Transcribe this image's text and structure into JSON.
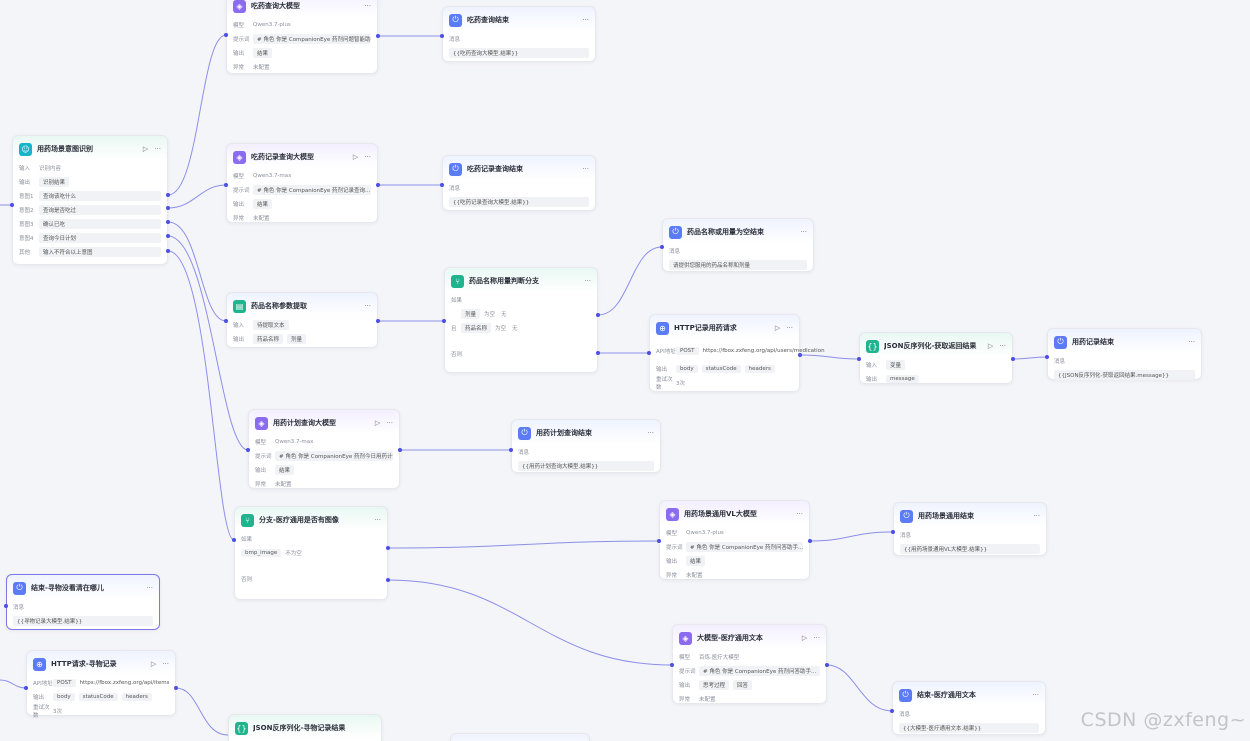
{
  "colors": {
    "accent": "#4b4fe3",
    "edge": "#8b8fe8",
    "selected_border": "#7a78e8"
  },
  "nodes": {
    "drug_query_llm": {
      "title": "吃药查询大模型",
      "icon": "model-icon",
      "r1l": "模型",
      "r1v": "Qwen3.7-plus",
      "r2l": "提示词",
      "r2v": "# 角色 你是 CompanionEye 药剂问题智能助手...",
      "r3l": "输出",
      "r3v": "结果",
      "r4l": "异常",
      "r4v": "未配置"
    },
    "drug_query_end": {
      "title": "吃药查询结束",
      "icon": "end-icon",
      "r1l": "消息",
      "r1v": "{{吃药查询大模型.结果}}"
    },
    "intent": {
      "title": "用药场景意图识别",
      "icon": "intent-icon",
      "r1l": "输入",
      "r1v": "识别内容",
      "r2l": "输出",
      "r2v": "识别结果",
      "r3l": "意图1",
      "r3v": "查询该吃什么",
      "r4l": "意图2",
      "r4v": "查询是否吃过",
      "r5l": "意图3",
      "r5v": "确认已吃",
      "r6l": "意图4",
      "r6v": "查询今日计划",
      "r7l": "其他",
      "r7v": "输入不符合以上意图"
    },
    "record_llm": {
      "title": "吃药记录查询大模型",
      "icon": "model-icon",
      "r1l": "模型",
      "r1v": "Qwen3.7-max",
      "r2l": "提示词",
      "r2v": "# 角色 你是 CompanionEye 药剂记录查询...",
      "r3l": "输出",
      "r3v": "结果",
      "r4l": "异常",
      "r4v": "未配置"
    },
    "record_end": {
      "title": "吃药记录查询结束",
      "icon": "end-icon",
      "r1l": "消息",
      "r1v": "{{吃药记录查询大模型.结果}}"
    },
    "empty_end": {
      "title": "药品名称或用量为空结束",
      "icon": "end-icon",
      "r1l": "消息",
      "r1v": "请提供您服用的药品名称和剂量"
    },
    "judge": {
      "title": "药品名称用量判断分支",
      "icon": "branch-icon",
      "if_label": "如果",
      "and_label": "且",
      "cond1a": "剂量",
      "cond1b": "为空",
      "cond1c": "无",
      "cond2a": "药品名称",
      "cond2b": "为空",
      "cond2c": "无",
      "else_label": "否则"
    },
    "param": {
      "title": "药品名称参数提取",
      "icon": "extract-icon",
      "r1l": "输入",
      "r1v": "待提取文本",
      "r2l": "输出",
      "r2v1": "药品名称",
      "r2v2": "剂量"
    },
    "http_record": {
      "title": "HTTP记录用药请求",
      "icon": "http-icon",
      "r1l": "API地址",
      "method": "POST",
      "url": "https://fbox.zxfeng.org/api/users/medication",
      "r2l": "输出",
      "o1": "body",
      "o2": "statusCode",
      "o3": "headers",
      "r3l": "重试次数",
      "r3v": "3次"
    },
    "json_parse": {
      "title": "JSON反序列化-获取返回结果",
      "icon": "json-icon",
      "r1l": "输入",
      "r1v": "变量",
      "r2l": "输出",
      "r2v": "message"
    },
    "record_done": {
      "title": "用药记录结束",
      "icon": "end-icon",
      "r1l": "消息",
      "r1v": "{{JSON反序列化-获取返回结果.message}}"
    },
    "plan_llm": {
      "title": "用药计划查询大模型",
      "icon": "model-icon",
      "r1l": "模型",
      "r1v": "Qwen3.7-max",
      "r2l": "提示词",
      "r2v": "# 角色 你是 CompanionEye 药剂今日用药计划...",
      "r3l": "输出",
      "r3v": "结果",
      "r4l": "异常",
      "r4v": "未配置"
    },
    "plan_end": {
      "title": "用药计划查询结束",
      "icon": "end-icon",
      "r1l": "消息",
      "r1v": "{{用药计划查询大模型.结果}}"
    },
    "image_branch": {
      "title": "分支-医疗通用是否有图像",
      "icon": "branch-icon",
      "if_label": "如果",
      "c1": "bmp_image",
      "c2": "不为空",
      "else_label": "否则"
    },
    "vl_llm": {
      "title": "用药场景通用VL大模型",
      "icon": "model-icon",
      "r1l": "模型",
      "r1v": "Qwen3.7-plus",
      "r2l": "提示词",
      "r2v": "# 角色 你是 CompanionEye 药剂问答助手...",
      "r3l": "输出",
      "r3v": "结果",
      "r4l": "异常",
      "r4v": "未配置"
    },
    "vl_end": {
      "title": "用药场景通用结束",
      "icon": "end-icon",
      "r1l": "消息",
      "r1v": "{{用药场景通用VL大模型.结果}}"
    },
    "lost_end": {
      "title": "结束-寻物没看清在哪儿",
      "icon": "end-icon",
      "r1l": "消息",
      "r1v": "{{寻物记录大模型.结果}}"
    },
    "http_find": {
      "title": "HTTP请求-寻物记录",
      "icon": "http-icon",
      "r1l": "API地址",
      "method": "POST",
      "url": "https://fbox.zxfeng.org/api/items",
      "r2l": "输出",
      "o1": "body",
      "o2": "statusCode",
      "o3": "headers",
      "r3l": "重试次数",
      "r3v": "3次"
    },
    "json_find": {
      "title": "JSON反序列化-寻物记录结果",
      "icon": "json-icon"
    },
    "text_llm": {
      "title": "大模型-医疗通用文本",
      "icon": "model-icon",
      "r1l": "模型",
      "r1v": "百炼·医疗大模型",
      "r2l": "提示词",
      "r2v": "# 角色 你是 CompanionEye 药剂问答助手...",
      "r3l": "输出",
      "o1": "思考过程",
      "o2": "回答",
      "r4l": "异常",
      "r4v": "未配置"
    },
    "text_end": {
      "title": "结束-医疗通用文本",
      "icon": "end-icon",
      "r1l": "消息",
      "r1v": "{{大模型-医疗通用文本.结果}}"
    }
  },
  "watermark": "CSDN @zxfeng~"
}
